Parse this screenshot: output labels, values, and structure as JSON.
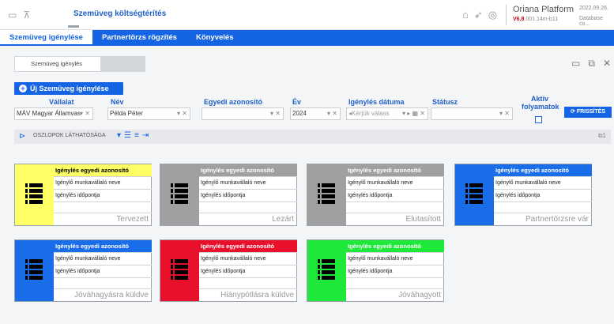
{
  "app": {
    "title": "Szemüveg költségtérítés",
    "platform": "Oriana Platform",
    "version_main": "V6.8",
    "version_rest": ".001.14m-b11",
    "date": "2022.09.26.",
    "database": "Database co..."
  },
  "nav": {
    "items": [
      "Szemüveg igénylése",
      "Partnertörzs rögzítés",
      "Könyvelés"
    ],
    "active": 0
  },
  "tab": {
    "label": "Szemüveg igénylés"
  },
  "new_button": {
    "label": "Új Szemüveg igénylése"
  },
  "filters": {
    "vallalat": {
      "label": "Vállalat",
      "value": "MÁV Magyar Államvas"
    },
    "nev": {
      "label": "Név",
      "value": "Példa Péter"
    },
    "azonosito": {
      "label": "Egyedi azonosító",
      "value": ""
    },
    "ev": {
      "label": "Év",
      "value": "2024"
    },
    "datum": {
      "label": "Igénylés dátuma",
      "placeholder": "Kérjük válass"
    },
    "statusz": {
      "label": "Státusz",
      "value": ""
    },
    "aktiv": {
      "label": "Aktív folyamatok"
    },
    "refresh": {
      "label": "FRISSÍTÉS"
    }
  },
  "columns_bar": {
    "label": "OSZLOPOK LÁTHATÓSÁGA",
    "count": "1"
  },
  "cards": [
    {
      "color": "#ffff66",
      "header_color": "#ffff66",
      "header_text_color": "#000",
      "h1": "Igénylés egyedi azonosító",
      "h2": "Igénylő munkavállaló neve",
      "h3": "Igénylés időpontja",
      "status": "Tervezett"
    },
    {
      "color": "#a0a0a0",
      "header_color": "#a0a0a0",
      "header_text_color": "#fff",
      "h1": "Igénylés egyedi azonosító",
      "h2": "Igénylő munkavállaló neve",
      "h3": "Igénylés időpontja",
      "status": "Lezárt"
    },
    {
      "color": "#a0a0a0",
      "header_color": "#a0a0a0",
      "header_text_color": "#fff",
      "h1": "Igénylés egyedi azonosító",
      "h2": "Igénylő munkavállaló neve",
      "h3": "Igénylés időpontja",
      "status": "Elutasított"
    },
    {
      "color": "#1a6de8",
      "header_color": "#1a6de8",
      "header_text_color": "#fff",
      "h1": "Igénylés egyedi azonosító",
      "h2": "Igénylő munkavállaló neve",
      "h3": "Igénylés időpontja",
      "status": "Partnertörzsre vár"
    },
    {
      "color": "#1a6de8",
      "header_color": "#1a6de8",
      "header_text_color": "#fff",
      "h1": "Igénylés egyedi azonosító",
      "h2": "Igénylő munkavállaló neve",
      "h3": "Igénylés időpontja",
      "status": "Jóváhagyásra küldve"
    },
    {
      "color": "#e8102a",
      "header_color": "#e8102a",
      "header_text_color": "#fff",
      "h1": "Igénylés egyedi azonosító",
      "h2": "Igénylő munkavállaló neve",
      "h3": "Igénylés időpontja",
      "status": "Hiánypótlásra küldve"
    },
    {
      "color": "#1ee83a",
      "header_color": "#1ee83a",
      "header_text_color": "#fff",
      "h1": "Igénylés egyedi azonosító",
      "h2": "Igénylő munkavállaló neve",
      "h3": "Igénylés időpontja",
      "status": "Jóváhagyott"
    }
  ]
}
